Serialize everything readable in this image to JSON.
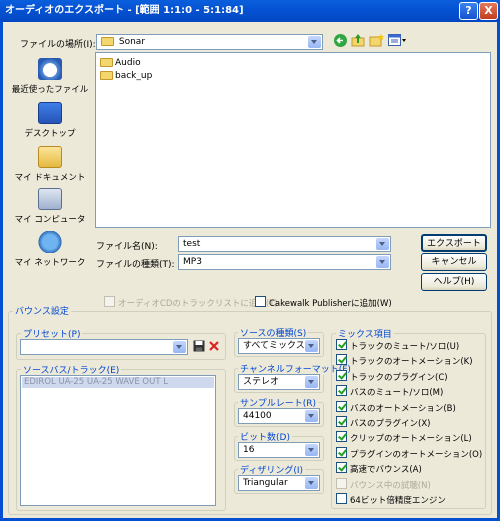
{
  "window": {
    "title": "オーディオのエクスポート - [範囲 1:1:0 - 5:1:84]",
    "help_glyph": "?",
    "close_glyph": "X"
  },
  "location": {
    "label": "ファイルの場所(I):",
    "value": "Sonar"
  },
  "places": [
    {
      "label": "最近使ったファイル",
      "icon": "recent-icon"
    },
    {
      "label": "デスクトップ",
      "icon": "desktop-icon"
    },
    {
      "label": "マイ ドキュメント",
      "icon": "my-documents-icon"
    },
    {
      "label": "マイ コンピュータ",
      "icon": "my-computer-icon"
    },
    {
      "label": "マイ ネットワーク",
      "icon": "my-network-icon"
    }
  ],
  "files": [
    {
      "name": "Audio"
    },
    {
      "name": "back_up"
    }
  ],
  "filename": {
    "label": "ファイル名(N):",
    "value": "test"
  },
  "filetype": {
    "label": "ファイルの種類(T):",
    "value": "MP3"
  },
  "buttons": {
    "export": "エクスポート",
    "cancel": "キャンセル",
    "help": "ヘルプ(H)"
  },
  "options": {
    "add_to_cd": "オーディオCDのトラックリストに追加(T)",
    "cakewalk_publisher": "Cakewalk Publisherに追加(W)"
  },
  "bounce": {
    "group_label": "バウンス設定",
    "preset_label": "プリセット(P)",
    "preset_value": "",
    "source_bus_label": "ソースバス/トラック(E)",
    "source_bus_item": "EDIROL UA-25 UA-25 WAVE OUT L",
    "source_type_label": "ソースの種類(S)",
    "source_type_value": "すべてミックス",
    "channel_format_label": "チャンネルフォーマット(F)",
    "channel_format_value": "ステレオ",
    "sample_rate_label": "サンプルレート(R)",
    "sample_rate_value": "44100",
    "bit_depth_label": "ビット数(D)",
    "bit_depth_value": "16",
    "dither_label": "ディザリング(I)",
    "dither_value": "Triangular"
  },
  "mix": {
    "group_label": "ミックス項目",
    "items": [
      {
        "label": "トラックのミュート/ソロ(U)",
        "checked": true
      },
      {
        "label": "トラックのオートメーション(K)",
        "checked": true
      },
      {
        "label": "トラックのプラグイン(C)",
        "checked": true
      },
      {
        "label": "バスのミュート/ソロ(M)",
        "checked": true
      },
      {
        "label": "バスのオートメーション(B)",
        "checked": true
      },
      {
        "label": "バスのプラグイン(X)",
        "checked": true
      },
      {
        "label": "クリップのオートメーション(L)",
        "checked": true
      },
      {
        "label": "プラグインのオートメーション(O)",
        "checked": true
      },
      {
        "label": "高速でバウンス(A)",
        "checked": true
      },
      {
        "label": "バウンス中の試聴(N)",
        "checked": false,
        "disabled": true
      },
      {
        "label": "64ビット倍精度エンジン",
        "checked": false
      }
    ]
  }
}
